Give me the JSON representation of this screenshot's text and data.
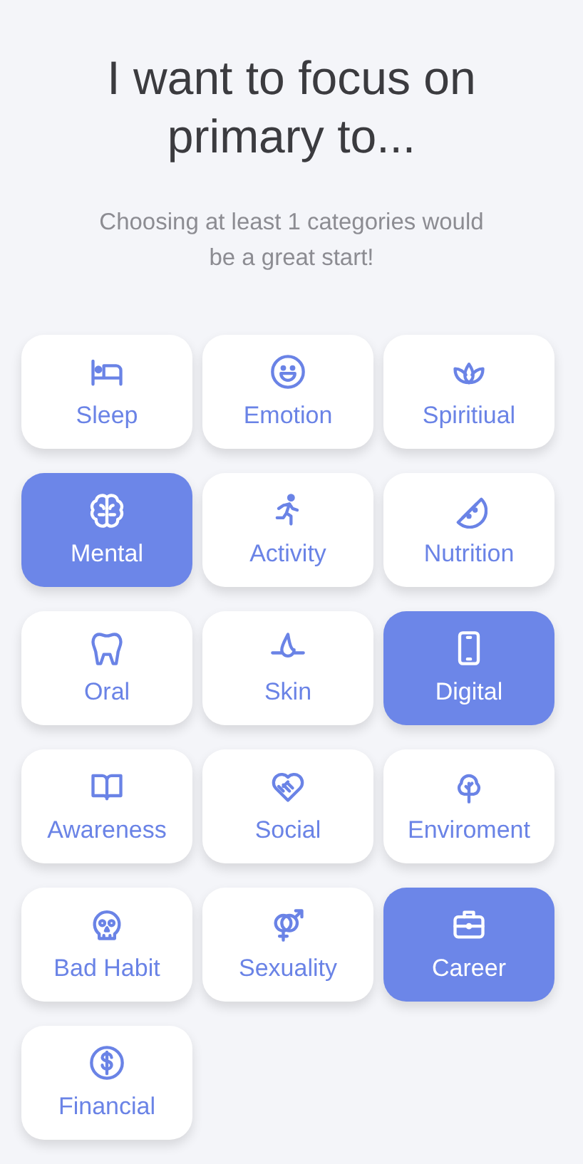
{
  "title": "I want to focus on primary to...",
  "subtitle": "Choosing at least 1 categories would be a great start!",
  "categories": [
    {
      "label": "Sleep",
      "selected": false
    },
    {
      "label": "Emotion",
      "selected": false
    },
    {
      "label": "Spiritiual",
      "selected": false
    },
    {
      "label": "Mental",
      "selected": true
    },
    {
      "label": "Activity",
      "selected": false
    },
    {
      "label": "Nutrition",
      "selected": false
    },
    {
      "label": "Oral",
      "selected": false
    },
    {
      "label": "Skin",
      "selected": false
    },
    {
      "label": "Digital",
      "selected": true
    },
    {
      "label": "Awareness",
      "selected": false
    },
    {
      "label": "Social",
      "selected": false
    },
    {
      "label": "Enviroment",
      "selected": false
    },
    {
      "label": "Bad Habit",
      "selected": false
    },
    {
      "label": "Sexuality",
      "selected": false
    },
    {
      "label": "Career",
      "selected": true
    },
    {
      "label": "Financial",
      "selected": false
    }
  ]
}
